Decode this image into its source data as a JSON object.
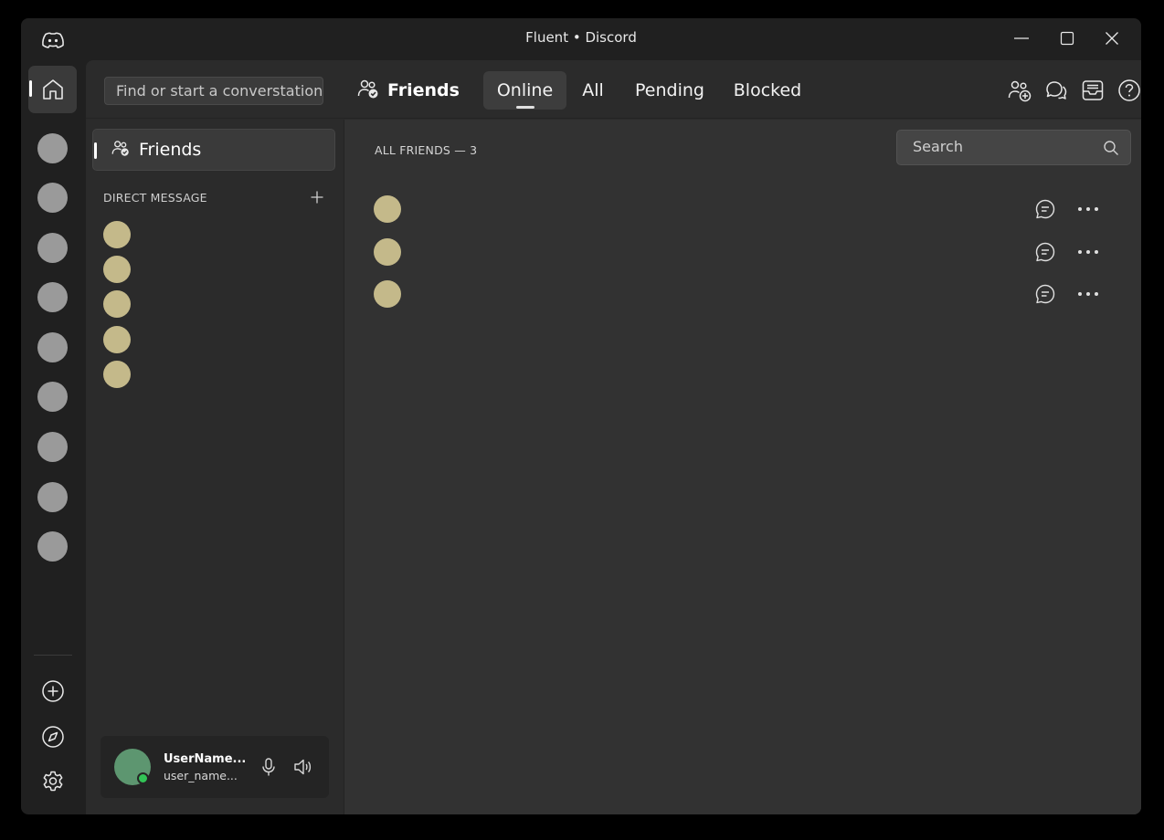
{
  "window": {
    "title": "Fluent • Discord"
  },
  "header": {
    "search_placeholder": "Find or start a converstation",
    "friends_label": "Friends",
    "tabs": [
      {
        "label": "Online",
        "active": true
      },
      {
        "label": "All",
        "active": false
      },
      {
        "label": "Pending",
        "active": false
      },
      {
        "label": "Blocked",
        "active": false
      }
    ],
    "actions": [
      "add-friend-icon",
      "new-group-dm-icon",
      "inbox-icon",
      "help-icon"
    ]
  },
  "rail": {
    "server_count": 9,
    "bottom_actions": [
      "add-server-icon",
      "explore-icon",
      "settings-icon"
    ]
  },
  "dm_panel": {
    "friends_label": "Friends",
    "section_label": "DIRECT MESSAGE",
    "dm_count": 5
  },
  "user": {
    "name": "UserName...",
    "handle": "user_name...",
    "status_color": "#32c456"
  },
  "friends_list": {
    "header": "ALL FRIENDS — 3",
    "search_placeholder": "Search",
    "count": 3
  },
  "colors": {
    "avatar": "#c4b98a",
    "server": "#9a9a9a",
    "user_avatar": "#5d9670"
  }
}
